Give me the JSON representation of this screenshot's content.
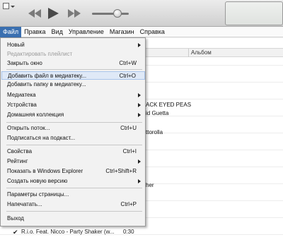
{
  "menubar": {
    "items": [
      "Файл",
      "Правка",
      "Вид",
      "Управление",
      "Магазин",
      "Справка"
    ]
  },
  "columns": {
    "album": "Альбом"
  },
  "background_fragments": [
    "ACK EYED PEAS",
    "id Guetta",
    "ttorolla",
    "her"
  ],
  "tracks": [
    {
      "checked": "✔",
      "title": "R.i.o. Feat. Nicco - Party Shaker (w...",
      "time": "0:30"
    }
  ],
  "file_menu": {
    "items": [
      {
        "label": "Новый",
        "shortcut": "",
        "submenu": true,
        "disabled": false
      },
      {
        "label": "Редактировать плейлист",
        "shortcut": "",
        "submenu": false,
        "disabled": true
      },
      {
        "label": "Закрыть окно",
        "shortcut": "Ctrl+W",
        "submenu": false,
        "disabled": false
      },
      {
        "label": "Добавить файл в медиатеку...",
        "shortcut": "Ctrl+O",
        "submenu": false,
        "disabled": false,
        "highlight": true
      },
      {
        "label": "Добавить папку в медиатеку...",
        "shortcut": "",
        "submenu": false,
        "disabled": false
      },
      {
        "label": "Медиатека",
        "shortcut": "",
        "submenu": true,
        "disabled": false
      },
      {
        "label": "Устройства",
        "shortcut": "",
        "submenu": true,
        "disabled": false
      },
      {
        "label": "Домашняя коллекция",
        "shortcut": "",
        "submenu": true,
        "disabled": false
      },
      {
        "label": "Открыть поток...",
        "shortcut": "Ctrl+U",
        "submenu": false,
        "disabled": false
      },
      {
        "label": "Подписаться на подкаст...",
        "shortcut": "",
        "submenu": false,
        "disabled": false
      },
      {
        "label": "Свойства",
        "shortcut": "Ctrl+I",
        "submenu": false,
        "disabled": false
      },
      {
        "label": "Рейтинг",
        "shortcut": "",
        "submenu": true,
        "disabled": false
      },
      {
        "label": "Показать в Windows Explorer",
        "shortcut": "Ctrl+Shift+R",
        "submenu": false,
        "disabled": false
      },
      {
        "label": "Создать новую версию",
        "shortcut": "",
        "submenu": true,
        "disabled": false
      },
      {
        "label": "Параметры страницы...",
        "shortcut": "",
        "submenu": false,
        "disabled": false
      },
      {
        "label": "Напечатать...",
        "shortcut": "Ctrl+P",
        "submenu": false,
        "disabled": false
      },
      {
        "label": "Выход",
        "shortcut": "",
        "submenu": false,
        "disabled": false
      }
    ]
  }
}
